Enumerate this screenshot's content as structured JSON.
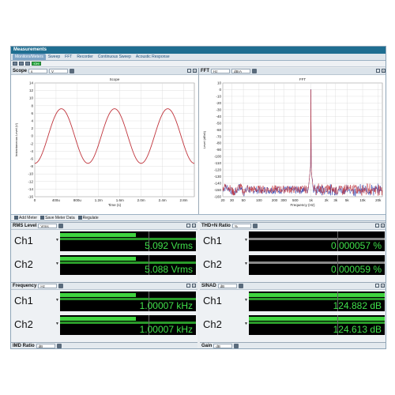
{
  "app": {
    "title": "Measurements"
  },
  "tabs": [
    "Monitors/Meters",
    "Sweep",
    "FFT",
    "Recorder",
    "Continuous Sweep",
    "Acoustic Response"
  ],
  "toolbar": {
    "toggle_label": "CH"
  },
  "scope": {
    "panel_title": "Scope",
    "x_unit": "s",
    "y_unit": "V",
    "chart_title": "Scope",
    "xlabel": "Time (s)",
    "ylabel": "Instantaneous Level (V)",
    "xticks": [
      "0",
      "400u",
      "800u",
      "1.2m",
      "1.6m",
      "2.0m",
      "2.4m",
      "2.8m"
    ],
    "yticks": [
      "14",
      "12",
      "10",
      "8",
      "6",
      "4",
      "2",
      "0",
      "-2",
      "-4",
      "-6",
      "-8",
      "-10",
      "-12",
      "-14",
      "-16"
    ]
  },
  "fft": {
    "panel_title": "FFT",
    "x_unit": "Hz",
    "y_unit": "dBrA",
    "chart_title": "FFT",
    "xlabel": "Frequency (Hz)",
    "ylabel": "Level (dBrA)",
    "xticks": [
      "20",
      "30",
      "50",
      "100",
      "200",
      "300",
      "500",
      "1k",
      "2k",
      "3k",
      "5k",
      "10k",
      "20k"
    ],
    "yticks": [
      "10",
      "0",
      "-10",
      "-20",
      "-30",
      "-40",
      "-50",
      "-60",
      "-70",
      "-80",
      "-90",
      "-100",
      "-110",
      "-120",
      "-130",
      "-140",
      "-150",
      "-160"
    ]
  },
  "meters_bar": {
    "add_meter": "Add Meter",
    "save_meter_data": "Save Meter Data",
    "regulate": "Regulate"
  },
  "meters": {
    "rms": {
      "title": "RMS Level",
      "unit_sel": "Vrms",
      "ch1_label": "Ch1",
      "ch2_label": "Ch2",
      "ch1_value": "5.092 Vrms",
      "ch2_value": "5.088 Vrms",
      "ch1_fill": 0.56,
      "ch2_fill": 0.56
    },
    "thdn": {
      "title": "THD+N Ratio",
      "unit_sel": "%",
      "ch1_label": "Ch1",
      "ch2_label": "Ch2",
      "ch1_value": "0.000057 %",
      "ch2_value": "0.000059 %",
      "ch1_fill": 0.0,
      "ch2_fill": 0.0
    },
    "freq": {
      "title": "Frequency",
      "unit_sel": "Hz",
      "ch1_label": "Ch1",
      "ch2_label": "Ch2",
      "ch1_value": "1.00007 kHz",
      "ch2_value": "1.00007 kHz",
      "ch1_fill": 0.56,
      "ch2_fill": 0.56
    },
    "sinad": {
      "title": "SINAD",
      "unit_sel": "dB",
      "ch1_label": "Ch1",
      "ch2_label": "Ch2",
      "ch1_value": "124.882 dB",
      "ch2_value": "124.613 dB",
      "ch1_fill": 1.0,
      "ch2_fill": 1.0
    },
    "imd": {
      "title": "IMD Ratio",
      "unit_sel": "dB"
    },
    "gain": {
      "title": "Gain",
      "unit_sel": "dB"
    }
  },
  "colors": {
    "display_bg": "#000000",
    "value_green": "#3fe04a",
    "bar_green": "#3fd43f",
    "trace_red": "#c0343c",
    "trace_blue": "#3a4db5"
  },
  "chart_data": [
    {
      "type": "line",
      "title": "Scope",
      "xlabel": "Time (s)",
      "ylabel": "Instantaneous Level (V)",
      "xlim": [
        0,
        0.003
      ],
      "ylim": [
        -16,
        14
      ],
      "series": [
        {
          "amplitude": 7.2,
          "frequency_hz": 1000,
          "phase_deg": 90
        }
      ]
    },
    {
      "type": "line",
      "title": "FFT",
      "xlabel": "Frequency (Hz)",
      "ylabel": "Level (dBrA)",
      "xscale": "log",
      "xlim": [
        20,
        24000
      ],
      "ylim": [
        -160,
        10
      ],
      "peak": {
        "x": 1000,
        "y": 0
      },
      "noise_floor_db": -150
    }
  ]
}
